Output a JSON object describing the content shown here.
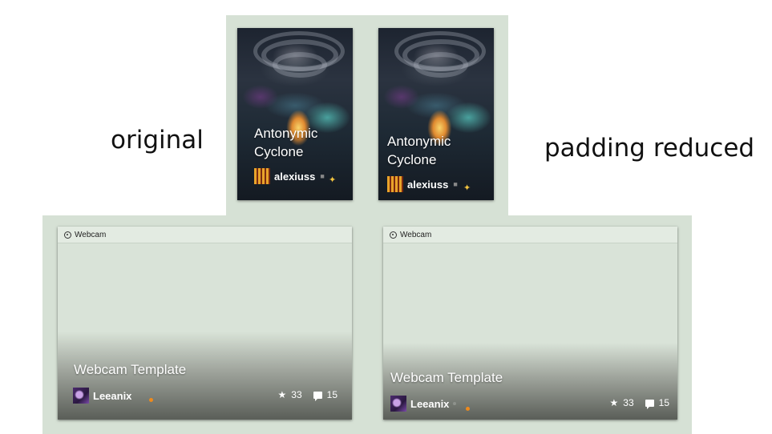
{
  "captions": {
    "left": "original",
    "right": "padding reduced"
  },
  "cover_cards": [
    {
      "title_line1": "Antonymic",
      "title_line2": "Cyclone",
      "user": "alexiuss"
    },
    {
      "title_line1": "Antonymic",
      "title_line2": "Cyclone",
      "user": "alexiuss"
    }
  ],
  "webcam_cards": [
    {
      "header": "Webcam",
      "title": "Webcam Template",
      "user": "Leeanix",
      "stars": "33",
      "comments": "15"
    },
    {
      "header": "Webcam",
      "title": "Webcam Template",
      "user": "Leeanix",
      "stars": "33",
      "comments": "15"
    }
  ],
  "colors": {
    "panel_background": "#d6e1d5",
    "webcam_header": "#e3ebe2",
    "status_dot": "#ee8a1c"
  },
  "icons": [
    "webcam-icon",
    "star-icon",
    "comment-icon"
  ]
}
